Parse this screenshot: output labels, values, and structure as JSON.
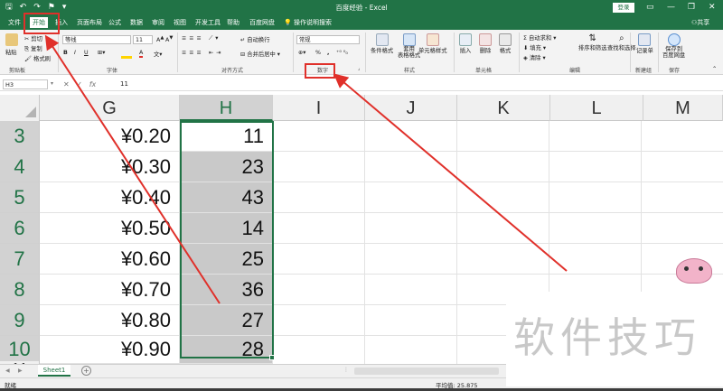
{
  "window": {
    "title": "百度经验 - Excel",
    "login_label": "登录",
    "controls": [
      "▭",
      "—",
      "❐",
      "✕"
    ]
  },
  "qat": {
    "icons": [
      "save-icon",
      "undo-icon",
      "redo-icon",
      "paint-icon"
    ]
  },
  "tabs": [
    {
      "label": "文件",
      "active": false
    },
    {
      "label": "开始",
      "active": true
    },
    {
      "label": "插入",
      "active": false
    },
    {
      "label": "页面布局",
      "active": false
    },
    {
      "label": "公式",
      "active": false
    },
    {
      "label": "数据",
      "active": false
    },
    {
      "label": "审阅",
      "active": false
    },
    {
      "label": "视图",
      "active": false
    },
    {
      "label": "开发工具",
      "active": false
    },
    {
      "label": "帮助",
      "active": false
    },
    {
      "label": "百度网盘",
      "active": false
    }
  ],
  "tell_me": "操作说明搜索",
  "share_label": "共享",
  "ribbon": {
    "clipboard": {
      "paste": "粘贴",
      "cut": "剪切",
      "copy": "复制",
      "format_painter": "格式刷",
      "group": "剪贴板"
    },
    "font": {
      "name": "等线",
      "size": "11",
      "group": "字体",
      "bold": "B",
      "italic": "I",
      "underline": "U"
    },
    "alignment": {
      "wrap": "自动换行",
      "merge": "合并后居中",
      "group": "对齐方式"
    },
    "number": {
      "format": "常规",
      "percent": "%",
      "comma": ",",
      "group": "数字"
    },
    "styles": {
      "conditional": "条件格式",
      "table": "套用\n表格格式",
      "cell": "单元格样式",
      "group": "样式"
    },
    "cells": {
      "insert": "插入",
      "delete": "删除",
      "format": "格式",
      "group": "单元格"
    },
    "editing": {
      "autosum": "自动求和",
      "fill": "填充",
      "clear": "清除",
      "sort": "排序和筛选",
      "find": "查找和选择",
      "group": "编辑"
    },
    "new_group": {
      "record": "记录单",
      "group": "新建组"
    },
    "save_group": {
      "save": "保存到\n百度网盘",
      "group": "保存"
    }
  },
  "formula_bar": {
    "name_box": "H3",
    "fx": "fx",
    "value": "11"
  },
  "columns": [
    "G",
    "H",
    "I",
    "J",
    "K",
    "L",
    "M"
  ],
  "rows": [
    {
      "row": "3",
      "g": "¥0.20",
      "h": "11"
    },
    {
      "row": "4",
      "g": "¥0.30",
      "h": "23"
    },
    {
      "row": "5",
      "g": "¥0.40",
      "h": "43"
    },
    {
      "row": "6",
      "g": "¥0.50",
      "h": "14"
    },
    {
      "row": "7",
      "g": "¥0.60",
      "h": "25"
    },
    {
      "row": "8",
      "g": "¥0.70",
      "h": "36"
    },
    {
      "row": "9",
      "g": "¥0.80",
      "h": "27"
    },
    {
      "row": "10",
      "g": "¥0.90",
      "h": "28"
    },
    {
      "row": "11",
      "g": "",
      "h": ""
    }
  ],
  "sheet_tabs": [
    {
      "label": "Sheet1",
      "active": true
    }
  ],
  "status": {
    "ready": "就绪",
    "average": "平均值: 25.875"
  },
  "watermark": "软件技巧",
  "colors": {
    "accent": "#217346",
    "annotation": "#e0302a"
  }
}
